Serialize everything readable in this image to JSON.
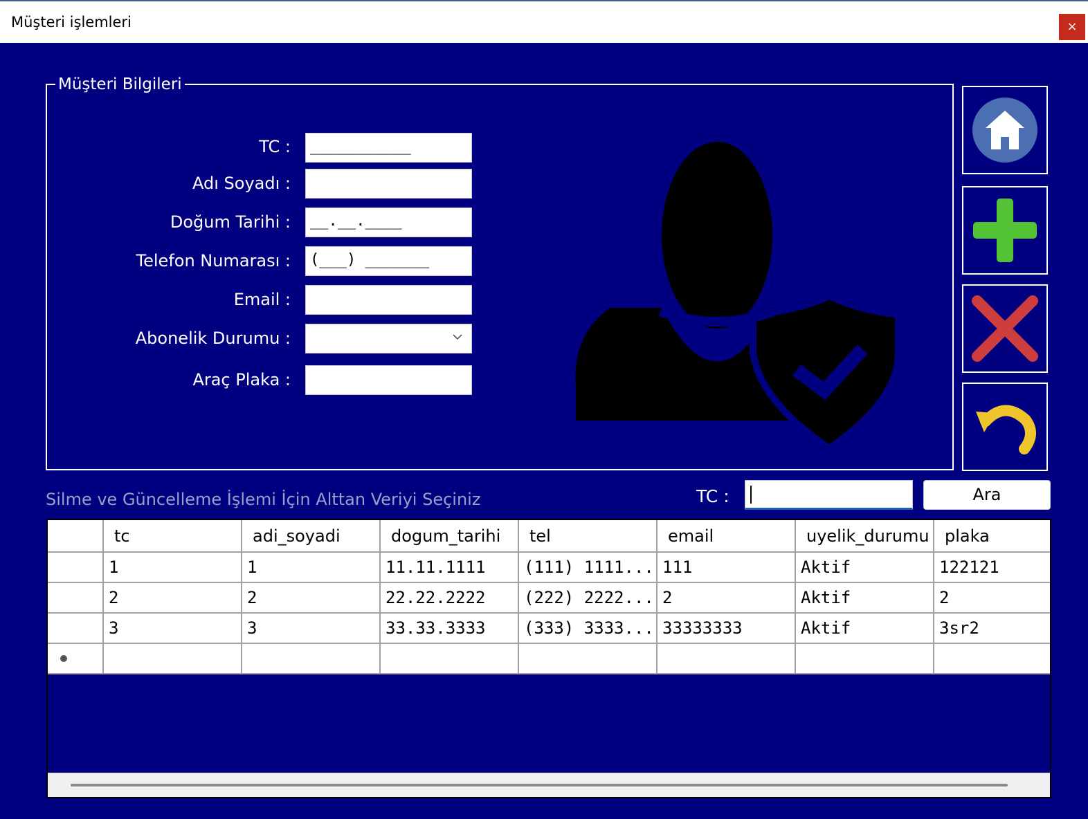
{
  "window": {
    "title": "Müşteri işlemleri",
    "close_glyph": "×"
  },
  "form": {
    "group_title": "Müşteri Bilgileri",
    "fields": [
      {
        "label": "TC :",
        "value": "___________"
      },
      {
        "label": "Adı Soyadı :",
        "value": ""
      },
      {
        "label": "Doğum Tarihi :",
        "value": "__.__.____"
      },
      {
        "label": "Telefon Numarası :",
        "value": "(___) _______"
      },
      {
        "label": "Email :",
        "value": ""
      },
      {
        "label": "Abonelik Durumu :",
        "value": ""
      },
      {
        "label": "Araç Plaka :",
        "value": ""
      }
    ]
  },
  "side_buttons": [
    "home-icon",
    "add-icon",
    "delete-icon",
    "undo-icon"
  ],
  "search": {
    "instruction": "Silme ve Güncelleme İşlemi İçin Alttan Veriyi Seçiniz",
    "label": "TC :",
    "value": "",
    "button": "Ara"
  },
  "grid": {
    "columns": [
      "tc",
      "adi_soyadi",
      "dogum_tarihi",
      "tel",
      "email",
      "uyelik_durumu",
      "plaka"
    ],
    "rows": [
      [
        "1",
        "1",
        "11.11.1111",
        "(111) 1111...",
        "111",
        "Aktif",
        "122121"
      ],
      [
        "2",
        "2",
        "22.22.2222",
        "(222) 2222...",
        "2",
        "Aktif",
        "2"
      ],
      [
        "3",
        "3",
        "33.33.3333",
        "(333) 3333...",
        "33333333",
        "Aktif",
        "3sr2"
      ]
    ]
  },
  "colors": {
    "background": "#000080",
    "close": "#c42b1c",
    "accent": "#1a5fb4"
  }
}
